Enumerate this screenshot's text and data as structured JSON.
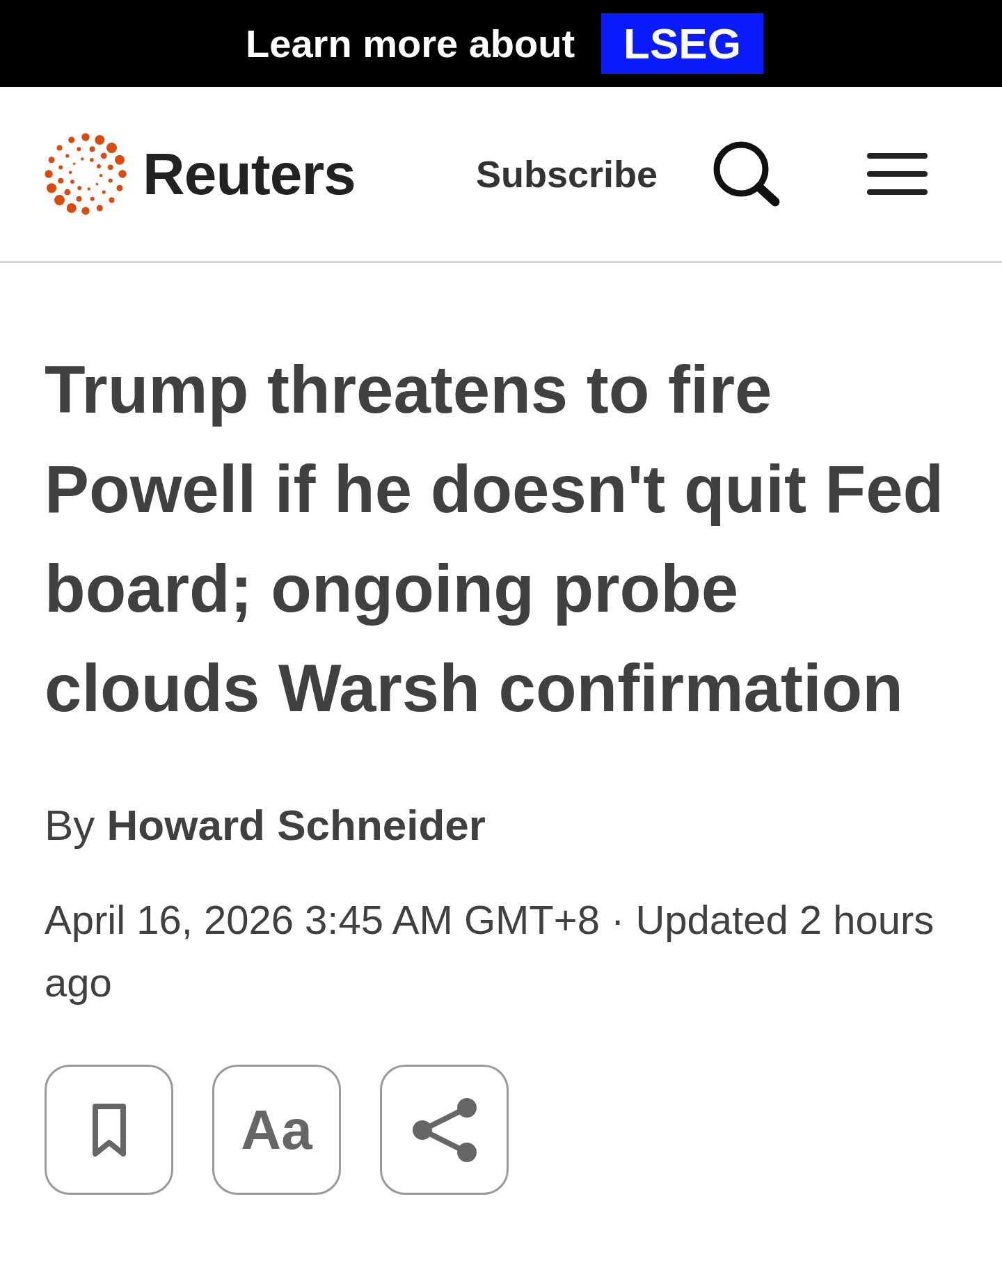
{
  "banner": {
    "text": "Learn more about",
    "brand": "LSEG"
  },
  "header": {
    "logo_text": "Reuters",
    "subscribe": "Subscribe"
  },
  "article": {
    "headline": "Trump threatens to fire Powell if he doesn't quit Fed board; ongoing probe clouds Warsh confirmation",
    "byline": "By **Howard Schneider**",
    "dateline": "April 16, 2026 3:45 AM GMT+8 · Updated 2 hours ago"
  },
  "actions": [
    {
      "kind": "bookmark"
    },
    {
      "kind": "text_size",
      "label": "Aa"
    },
    {
      "kind": "share"
    }
  ]
}
